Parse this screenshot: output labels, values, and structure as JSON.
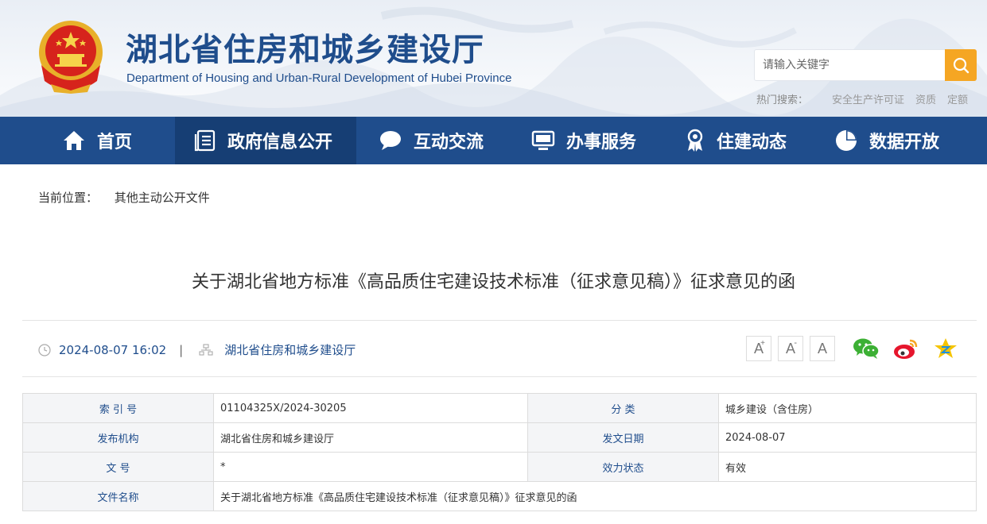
{
  "header": {
    "title": "湖北省住房和城乡建设厅",
    "subtitle": "Department of Housing and Urban-Rural Development of Hubei Province",
    "search_placeholder": "请输入关键字",
    "hot_search_label": "热门搜索：",
    "hot_search_items": [
      "安全生产许可证",
      "资质",
      "定额"
    ]
  },
  "nav": {
    "items": [
      {
        "label": "首页",
        "icon": "home-icon"
      },
      {
        "label": "政府信息公开",
        "icon": "document-list-icon",
        "active": true
      },
      {
        "label": "互动交流",
        "icon": "chat-bubble-icon"
      },
      {
        "label": "办事服务",
        "icon": "monitor-icon"
      },
      {
        "label": "住建动态",
        "icon": "award-icon"
      },
      {
        "label": "数据开放",
        "icon": "pie-chart-icon"
      }
    ]
  },
  "breadcrumb": {
    "label": "当前位置：",
    "current": "其他主动公开文件"
  },
  "article": {
    "title": "关于湖北省地方标准《高品质住宅建设技术标准（征求意见稿）》征求意见的函",
    "date": "2024-08-07 16:02",
    "separator": "|",
    "source": "湖北省住房和城乡建设厅"
  },
  "font_controls": [
    "A+",
    "A-",
    "A"
  ],
  "share": [
    "wechat-icon",
    "weibo-icon",
    "qzone-icon"
  ],
  "colors": {
    "brand_blue": "#1f4d8c",
    "nav_active": "#163e74",
    "search_orange": "#f5a623"
  },
  "info_table": {
    "index_label": "索 引 号",
    "index_value": "01104325X/2024-30205",
    "category_label": "分 类",
    "category_value": "城乡建设（含住房）",
    "publisher_label": "发布机构",
    "publisher_value": "湖北省住房和城乡建设厅",
    "pubdate_label": "发文日期",
    "pubdate_value": "2024-08-07",
    "docno_label": "文 号",
    "docno_value": "*",
    "status_label": "效力状态",
    "status_value": "有效",
    "filename_label": "文件名称",
    "filename_value": "关于湖北省地方标准《高品质住宅建设技术标准（征求意见稿）》征求意见的函"
  }
}
